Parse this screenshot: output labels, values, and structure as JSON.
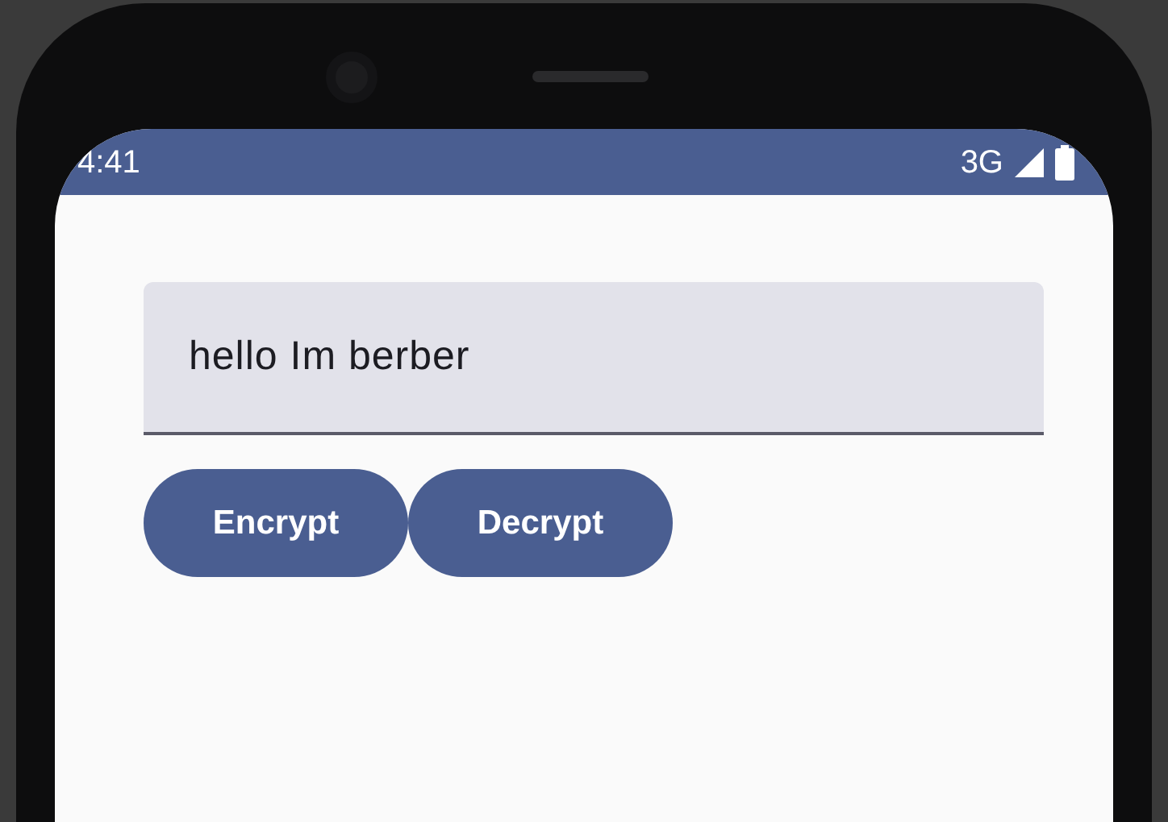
{
  "status_bar": {
    "time": "4:41",
    "network": "3G"
  },
  "text_field": {
    "value": "hello Im berber"
  },
  "buttons": [
    {
      "label": "Encrypt"
    },
    {
      "label": "Decrypt"
    }
  ]
}
